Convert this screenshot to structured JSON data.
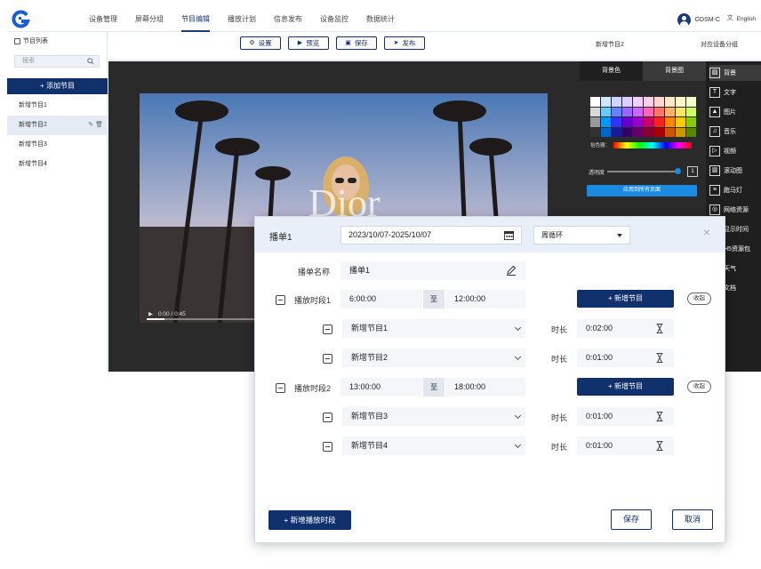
{
  "topbar": {
    "nav": [
      "设备管理",
      "屏幕分组",
      "节目编辑",
      "播放计划",
      "信息发布",
      "设备监控",
      "数据统计"
    ],
    "active_nav": "节目编辑",
    "user": "GDSM-C",
    "language": "English"
  },
  "sidebar": {
    "title": "节目列表",
    "search_placeholder": "搜索",
    "add_label": "+ 添加节目",
    "items": [
      "新增节目1",
      "新增节目2",
      "新增节目3",
      "新增节目4"
    ],
    "selected": "新增节目2"
  },
  "toolbar": {
    "settings": "设置",
    "preview": "预览",
    "save": "保存",
    "publish": "发布",
    "current_program": "新增节目2",
    "device_group": "对应设备分组"
  },
  "canvas": {
    "watermark_text": "Dior",
    "time": "0:00 / 0:45"
  },
  "right_panel": {
    "tab_bg_color": "背景色",
    "tab_bg_image": "背景图",
    "picker_label": "拾色器：",
    "opacity_label": "透明度",
    "opacity_value": "1",
    "apply_label": "应用到所有页面",
    "palette": [
      "#ffffff",
      "#cce8ff",
      "#cfd5ff",
      "#dcd0ff",
      "#f0d0ff",
      "#ffd0e8",
      "#ffd6d0",
      "#ffe8cc",
      "#fff5cc",
      "#f0ffcc",
      "#d9d9d9",
      "#66ccff",
      "#6680ff",
      "#9966ff",
      "#cc66ff",
      "#ff66b3",
      "#ff7566",
      "#ffb366",
      "#ffe566",
      "#ccff66",
      "#999999",
      "#0099ff",
      "#3333ff",
      "#6600cc",
      "#9900cc",
      "#cc0066",
      "#ff2222",
      "#ff8800",
      "#ffcc00",
      "#88cc00",
      "#333333",
      "#0066cc",
      "#1a1a99",
      "#330066",
      "#660066",
      "#880033",
      "#aa0000",
      "#cc5500",
      "#cc9900",
      "#558800"
    ]
  },
  "tools": [
    {
      "label": "背景",
      "icon": "background-icon"
    },
    {
      "label": "文字",
      "icon": "text-icon"
    },
    {
      "label": "图片",
      "icon": "image-icon"
    },
    {
      "label": "音乐",
      "icon": "music-icon"
    },
    {
      "label": "视频",
      "icon": "video-icon"
    },
    {
      "label": "滚动图",
      "icon": "scroll-image-icon"
    },
    {
      "label": "跑马灯",
      "icon": "marquee-icon"
    },
    {
      "label": "网络资源",
      "icon": "web-resource-icon"
    },
    {
      "label": "显示时间",
      "icon": "clock-icon"
    },
    {
      "label": "H5资源包",
      "icon": "h5-package-icon"
    },
    {
      "label": "天气",
      "icon": "weather-icon"
    },
    {
      "label": "文档",
      "icon": "document-icon"
    }
  ],
  "dialog": {
    "title": "播单1",
    "date_range": "2023/10/07-2025/10/07",
    "loop_mode": "周循环",
    "name_label": "播单名称",
    "name_value": "播单1",
    "to_label": "至",
    "duration_label": "时长",
    "add_program": "+ 新增节目",
    "collapse": "收起",
    "periods": [
      {
        "label": "播放时段1",
        "start": "6:00:00",
        "end": "12:00:00",
        "programs": [
          {
            "name": "新增节目1",
            "duration": "0:02:00"
          },
          {
            "name": "新增节目2",
            "duration": "0:01:00"
          }
        ]
      },
      {
        "label": "播放时段2",
        "start": "13:00:00",
        "end": "18:00:00",
        "programs": [
          {
            "name": "新增节目3",
            "duration": "0:01:00"
          },
          {
            "name": "新增节目4",
            "duration": "0:01:00"
          }
        ]
      }
    ],
    "add_period": "+ 新增播放时段",
    "save": "保存",
    "cancel": "取消"
  }
}
